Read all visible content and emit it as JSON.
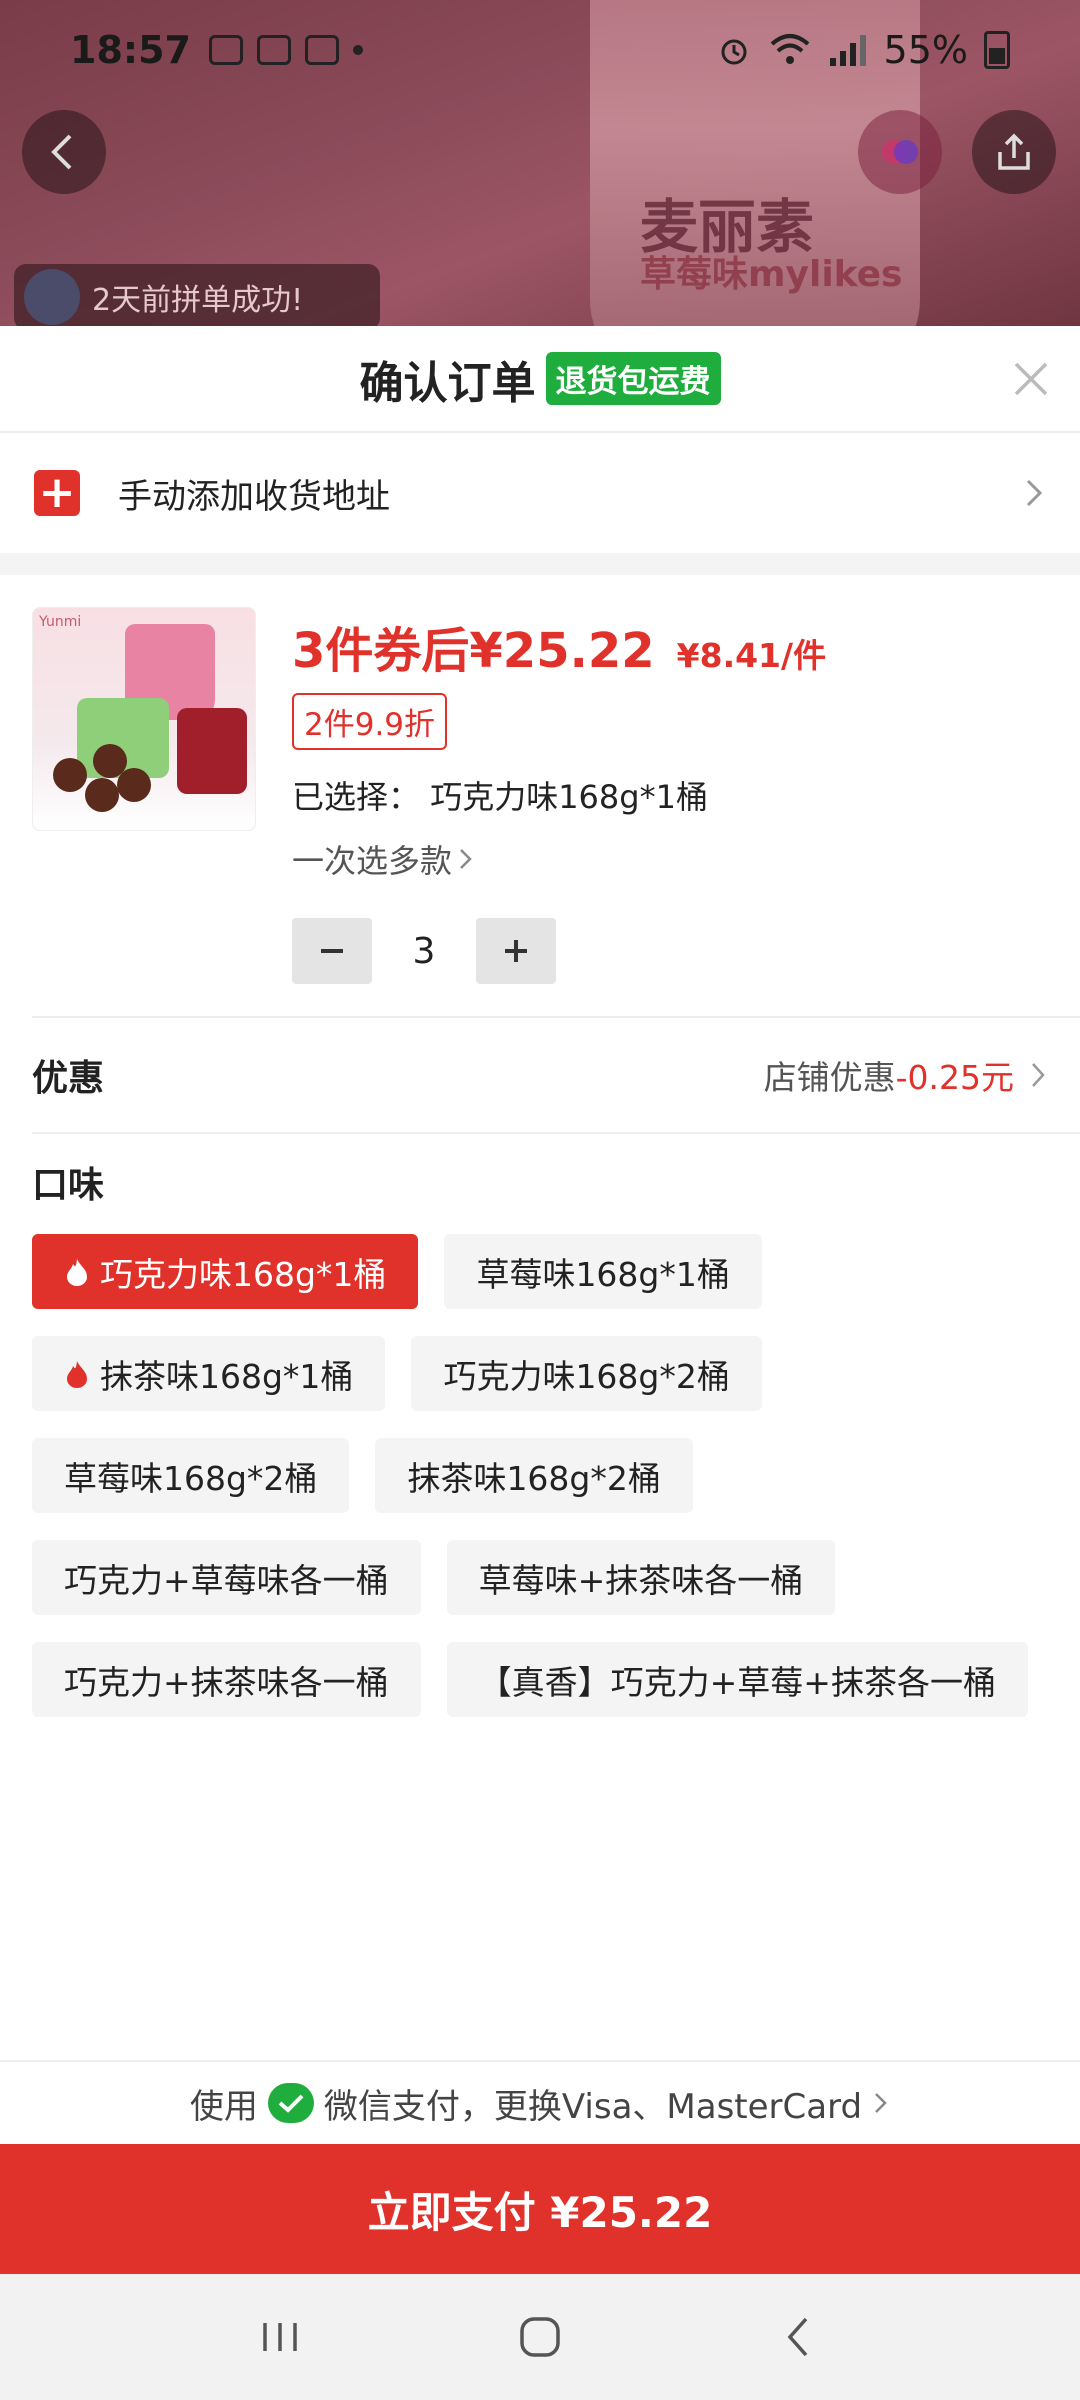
{
  "status_bar": {
    "time": "18:57",
    "battery": "55%"
  },
  "background": {
    "brand_logo_text": "Yunmi 运蜜说话",
    "product_label": "麦丽素",
    "product_sublabel": "草莓味mylikes",
    "group_buy_text": "2天前拼单成功!"
  },
  "sheet": {
    "title": "确认订单",
    "return_badge": "退货包运费",
    "address_label": "手动添加收货地址",
    "product": {
      "price_after_coupon": "3件券后¥25.22",
      "unit_price": "¥8.41/件",
      "discount_tag": "2件9.9折",
      "selected_label": "已选择：",
      "selected_value": "巧克力味168g*1桶",
      "multi_select": "一次选多款",
      "quantity": "3"
    },
    "promo": {
      "label": "优惠",
      "store_discount": "店铺优惠",
      "amount": "-0.25元"
    },
    "flavor": {
      "title": "口味",
      "options": [
        "巧克力味168g*1桶",
        "草莓味168g*1桶",
        "抹茶味168g*1桶",
        "巧克力味168g*2桶",
        "草莓味168g*2桶",
        "抹茶味168g*2桶",
        "巧克力+草莓味各一桶",
        "草莓味+抹茶味各一桶",
        "巧克力+抹茶味各一桶",
        "【真香】巧克力+草莓+抹茶各一桶"
      ],
      "selected_index": 0
    },
    "payment": {
      "prefix": "使用",
      "method": "微信支付，更换Visa、MasterCard",
      "pay_button": "立即支付 ¥25.22"
    }
  },
  "colors": {
    "accent_red": "#e0312b",
    "green_badge": "#1fad3e"
  }
}
